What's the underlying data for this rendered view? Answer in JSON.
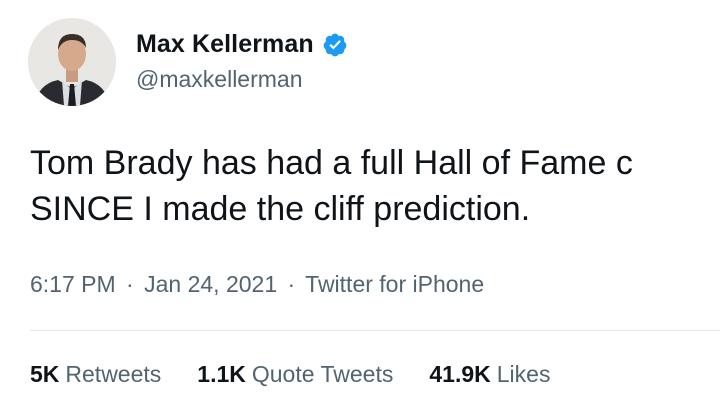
{
  "user": {
    "display_name": "Max Kellerman",
    "handle": "@maxkellerman",
    "verified": true,
    "verified_color": "#1d9bf0"
  },
  "tweet": {
    "lines": [
      "Tom Brady has had a full Hall of Fame c",
      "SINCE I made the cliff prediction."
    ],
    "time": "6:17 PM",
    "date": "Jan 24, 2021",
    "source": "Twitter for iPhone",
    "separator": "·"
  },
  "stats": {
    "retweets_count": "5K",
    "retweets_label": "Retweets",
    "quote_count": "1.1K",
    "quote_label": "Quote Tweets",
    "likes_count": "41.9K",
    "likes_label": "Likes"
  }
}
